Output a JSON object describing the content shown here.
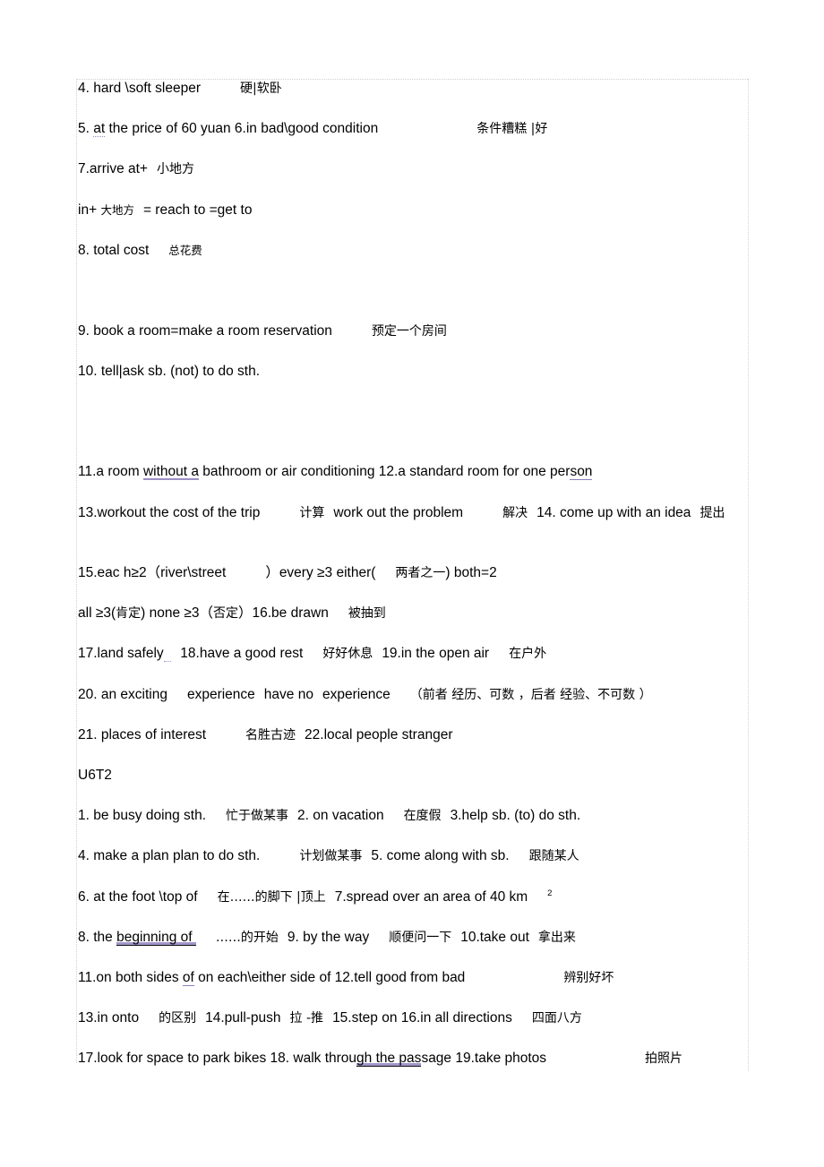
{
  "document": {
    "sections": [
      {
        "id": "u6t1-continued",
        "lines": [
          {
            "id": "l4",
            "text": "4. hard \\soft sleeper",
            "gloss": "硬|软卧"
          },
          {
            "id": "l5",
            "text_a": "5. ",
            "marked": "at",
            "text_b": " the price of 60 yuan 6.in bad\\good condition",
            "gloss": "条件糟糕 |好"
          },
          {
            "id": "l7",
            "text": "7.arrive at+",
            "gloss": "小地方"
          },
          {
            "id": "l7b",
            "text_a": "in+ ",
            "gloss": "大地方",
            "text_b": "= reach to =get to"
          },
          {
            "id": "l8",
            "text": "8. total cost",
            "gloss": "总花费"
          },
          {
            "id": "l9",
            "text": "9. book a room=make a room reservation",
            "gloss": "预定一个房间"
          },
          {
            "id": "l10",
            "text": "10. tell|ask sb. (not) to do sth."
          },
          {
            "id": "l11",
            "text_a": "11.a room ",
            "marked": "without a",
            "text_b": " bathroom or air conditioning 12.a standard room for one per",
            "marked2": "son"
          },
          {
            "id": "l13",
            "text_a": "13.workout the cost of the trip",
            "gloss_a": "计算",
            "text_b": "work out the problem",
            "gloss_b": "解决",
            "text_c": "14. come up with an idea",
            "gloss_c": "提出"
          },
          {
            "id": "l15",
            "text_a": "15.eac h≥2（river\\street",
            "text_b": "）every ≥3 either(",
            "gloss_a": "两者之一",
            "text_c": ") both=2"
          },
          {
            "id": "l15b",
            "text_a": "all ≥3(",
            "gloss_a": "肯定",
            "text_b": ") none ≥3（",
            "gloss_b": "否定",
            "text_c": "）16.be drawn",
            "gloss_c": "被抽到"
          },
          {
            "id": "l17",
            "text_a": "17.land safely",
            "text_b": "18.have a good rest",
            "gloss_a": "好好休息",
            "text_c": "19.in the open air",
            "gloss_b": "在户外"
          },
          {
            "id": "l20",
            "text_a": "20. an exciting",
            "text_b": "experience",
            "text_c": "have no",
            "text_d": "experience",
            "gloss_a": "（前者 经历、可数 ，后者 经验、不可数 ）"
          },
          {
            "id": "l21",
            "text_a": "21. places of interest",
            "gloss_a": "名胜古迹",
            "text_b": "22.local people stranger"
          }
        ]
      },
      {
        "id": "u6t2",
        "heading": "U6T2",
        "lines": [
          {
            "id": "t2l1",
            "text_a": "1. be busy doing sth.",
            "gloss_a": "忙于做某事",
            "text_b": "2. on vacation",
            "gloss_b": "在度假",
            "text_c": "3.help sb. (to) do sth."
          },
          {
            "id": "t2l4",
            "text_a": "4. make a plan plan to do sth.",
            "gloss_a": "计划做某事",
            "text_b": "5. come along with sb.",
            "gloss_b": "跟随某人"
          },
          {
            "id": "t2l6",
            "text_a": "6. at the foot \\top of",
            "gloss_a": "在……的脚下 |顶上",
            "text_b": "7.spread over an area of 40 km",
            "sup": "2"
          },
          {
            "id": "t2l8",
            "text_a": "8. the ",
            "marked": "beginning of ",
            "gloss_a": "……的开始",
            "text_b": "9. by the way",
            "gloss_b": "顺便问一下",
            "text_c": "10.take out",
            "gloss_c": "拿出来"
          },
          {
            "id": "t2l11",
            "text_a": "11.on both sides ",
            "marked": "of",
            "text_b": " on each\\either side of 12.tell good from bad",
            "gloss_a": "辨别好坏"
          },
          {
            "id": "t2l13",
            "text_a": "13.in onto",
            "gloss_a": "的区别",
            "text_b": "14.pull-push",
            "gloss_b": "拉 -推",
            "text_c": "15.step on 16.in all directions",
            "gloss_c": "四面八方"
          },
          {
            "id": "t2l17",
            "text_a": "17.look for space to park bikes 18. walk throu",
            "marked": "gh the pas",
            "text_b": "sage 19.take photos",
            "gloss_a": "拍照片"
          }
        ]
      }
    ]
  },
  "style": {
    "marker_color": "#9d8fc6",
    "text_color": "#000000",
    "page_background": "#ffffff",
    "frame_color": "#cfcfcf"
  }
}
